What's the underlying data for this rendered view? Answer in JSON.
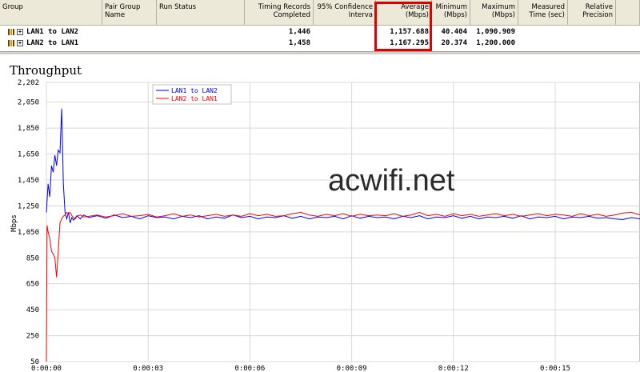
{
  "table": {
    "headers": [
      {
        "text": "Group",
        "align": "l"
      },
      {
        "text": "Pair Group\nName",
        "align": "l"
      },
      {
        "text": "Run Status",
        "align": "l"
      },
      {
        "text": "Timing Records\nCompleted",
        "align": "r"
      },
      {
        "text": "95% Confidence\nInterva",
        "align": "r"
      },
      {
        "text": "Average\n(Mbps)",
        "align": "r"
      },
      {
        "text": "Minimum\n(Mbps)",
        "align": "r"
      },
      {
        "text": "Maximum\n(Mbps)",
        "align": "r"
      },
      {
        "text": "Measured\nTime (sec)",
        "align": "r"
      },
      {
        "text": "Relative\nPrecision",
        "align": "r"
      }
    ],
    "rows": [
      {
        "group": "LAN1 to LAN2",
        "records": "1,446",
        "average": "1,157.688",
        "minimum": "40.404",
        "maximum": "1,090.909"
      },
      {
        "group": "LAN2 to LAN1",
        "records": "1,458",
        "average": "1,167.295",
        "minimum": "20.374",
        "maximum": "1,200.000"
      }
    ]
  },
  "highlight_color": "#e00000",
  "watermark": "acwifi.net",
  "chart_data": {
    "type": "line",
    "title": "Throughput",
    "ylabel": "Mbps",
    "xlabel": "",
    "ylim": [
      50,
      2202
    ],
    "yticks": [
      50,
      250,
      450,
      650,
      850,
      1050,
      1250,
      1450,
      1650,
      1850,
      2050,
      2202
    ],
    "ytick_labels": [
      "50",
      "250",
      "450",
      "650",
      "850",
      "1,050",
      "1,250",
      "1,450",
      "1,650",
      "1,850",
      "2,050",
      "2,202"
    ],
    "xlim": [
      0,
      17.5
    ],
    "xticks": [
      0,
      3,
      6,
      9,
      12,
      15
    ],
    "xtick_labels": [
      "0:00:00",
      "0:00:03",
      "0:00:06",
      "0:00:09",
      "0:00:12",
      "0:00:15"
    ],
    "grid": true,
    "legend": "top-left",
    "series": [
      {
        "name": "LAN1 to LAN2",
        "color": "#0000ff",
        "x": [
          0.0,
          0.05,
          0.1,
          0.15,
          0.2,
          0.25,
          0.3,
          0.35,
          0.4,
          0.45,
          0.5,
          0.55,
          0.6,
          0.65,
          0.7,
          0.75,
          0.8,
          0.9,
          1.0,
          1.1,
          1.25,
          1.5,
          1.75,
          2.0,
          2.25,
          2.5,
          2.75,
          3.0,
          3.25,
          3.5,
          3.75,
          4.0,
          4.25,
          4.5,
          4.75,
          5.0,
          5.25,
          5.5,
          5.75,
          6.0,
          6.25,
          6.5,
          6.75,
          7.0,
          7.25,
          7.5,
          7.75,
          8.0,
          8.25,
          8.5,
          8.75,
          9.0,
          9.25,
          9.5,
          9.75,
          10.0,
          10.25,
          10.5,
          10.75,
          11.0,
          11.25,
          11.5,
          11.75,
          12.0,
          12.25,
          12.5,
          12.75,
          13.0,
          13.25,
          13.5,
          13.75,
          14.0,
          14.25,
          14.5,
          14.75,
          15.0,
          15.25,
          15.5,
          15.75,
          16.0,
          16.25,
          16.5,
          16.75,
          17.0,
          17.25,
          17.5
        ],
        "y": [
          1200,
          1420,
          1320,
          1560,
          1510,
          1640,
          1560,
          1680,
          1660,
          2000,
          1420,
          1200,
          1150,
          1200,
          1120,
          1160,
          1140,
          1175,
          1150,
          1180,
          1160,
          1175,
          1155,
          1180,
          1160,
          1170,
          1150,
          1175,
          1160,
          1165,
          1150,
          1170,
          1160,
          1175,
          1150,
          1165,
          1155,
          1180,
          1160,
          1170,
          1150,
          1165,
          1160,
          1175,
          1155,
          1170,
          1150,
          1165,
          1160,
          1170,
          1150,
          1175,
          1155,
          1170,
          1160,
          1165,
          1150,
          1170,
          1160,
          1175,
          1150,
          1165,
          1160,
          1175,
          1155,
          1170,
          1150,
          1165,
          1160,
          1170,
          1155,
          1175,
          1150,
          1165,
          1160,
          1170,
          1150,
          1165,
          1160,
          1170,
          1155,
          1160,
          1150,
          1145,
          1160,
          1150
        ]
      },
      {
        "name": "LAN2 to LAN1",
        "color": "#ff0000",
        "x": [
          0.0,
          0.02,
          0.05,
          0.1,
          0.15,
          0.2,
          0.25,
          0.3,
          0.35,
          0.4,
          0.45,
          0.5,
          0.55,
          0.6,
          0.65,
          0.7,
          0.75,
          0.8,
          0.85,
          0.9,
          1.0,
          1.1,
          1.25,
          1.5,
          1.75,
          2.0,
          2.25,
          2.5,
          2.75,
          3.0,
          3.25,
          3.5,
          3.75,
          4.0,
          4.25,
          4.5,
          4.75,
          5.0,
          5.25,
          5.5,
          5.75,
          6.0,
          6.25,
          6.5,
          6.75,
          7.0,
          7.25,
          7.5,
          7.75,
          8.0,
          8.25,
          8.5,
          8.75,
          9.0,
          9.25,
          9.5,
          9.75,
          10.0,
          10.25,
          10.5,
          10.75,
          11.0,
          11.25,
          11.5,
          11.75,
          12.0,
          12.25,
          12.5,
          12.75,
          13.0,
          13.25,
          13.5,
          13.75,
          14.0,
          14.25,
          14.5,
          14.75,
          15.0,
          15.25,
          15.5,
          15.75,
          16.0,
          16.25,
          16.5,
          16.75,
          17.0,
          17.25,
          17.5
        ],
        "y": [
          50,
          1100,
          1050,
          1000,
          900,
          880,
          850,
          700,
          900,
          1120,
          1150,
          1170,
          1180,
          1200,
          1190,
          1200,
          1175,
          1160,
          1150,
          1170,
          1180,
          1165,
          1170,
          1180,
          1165,
          1175,
          1190,
          1170,
          1175,
          1185,
          1165,
          1175,
          1190,
          1170,
          1180,
          1165,
          1175,
          1185,
          1170,
          1180,
          1170,
          1190,
          1175,
          1185,
          1170,
          1175,
          1190,
          1200,
          1180,
          1170,
          1185,
          1175,
          1190,
          1170,
          1185,
          1175,
          1180,
          1175,
          1190,
          1170,
          1180,
          1200,
          1175,
          1185,
          1170,
          1190,
          1175,
          1185,
          1170,
          1180,
          1190,
          1175,
          1185,
          1170,
          1180,
          1190,
          1175,
          1185,
          1180,
          1170,
          1190,
          1175,
          1185,
          1170,
          1180,
          1195,
          1200,
          1180
        ]
      }
    ]
  }
}
